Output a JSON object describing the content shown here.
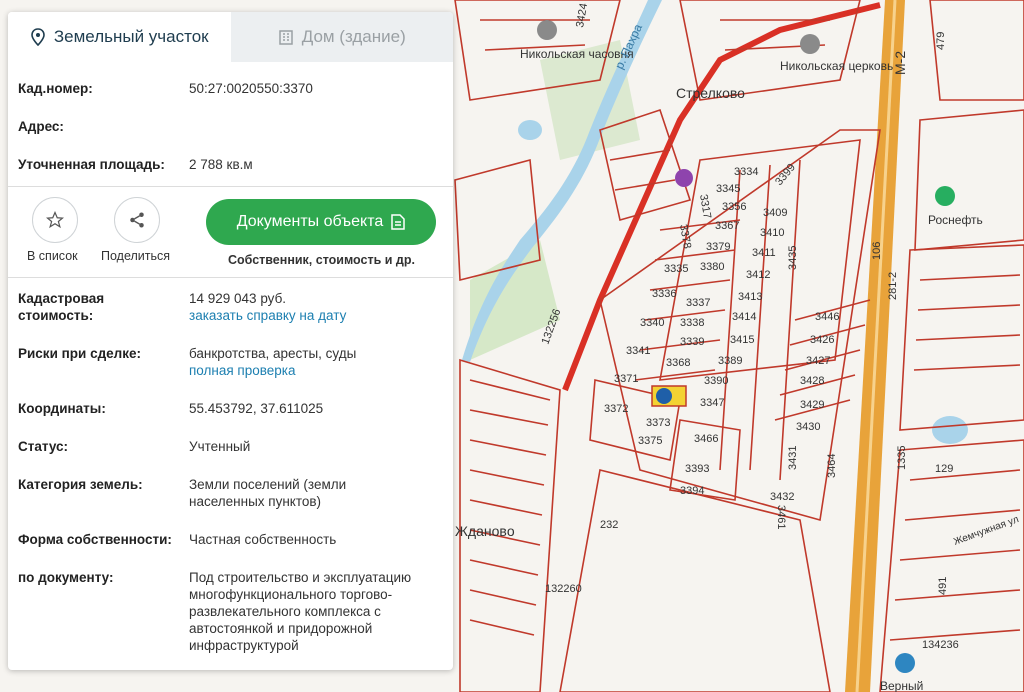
{
  "tabs": [
    {
      "label": "Земельный участок",
      "icon": "pin-icon"
    },
    {
      "label": "Дом (здание)",
      "icon": "building-icon"
    }
  ],
  "info": {
    "cadnum_label": "Кад.номер:",
    "cadnum_value": "50:27:0020550:3370",
    "address_label": "Адрес:",
    "area_label": "Уточненная площадь:",
    "area_value": "2 788 кв.м"
  },
  "actions": {
    "fav_label": "В список",
    "share_label": "Поделиться",
    "docs_button": "Документы объекта",
    "docs_sub": "Собственник, стоимость и др."
  },
  "details": {
    "cost_label_1": "Кадастровая",
    "cost_label_2": "стоимость:",
    "cost_value": "14 929 043 руб.",
    "cost_link": "заказать справку на дату",
    "risk_label": "Риски при сделке:",
    "risk_value": "банкротства, аресты, суды",
    "risk_link": "полная проверка",
    "coords_label": "Координаты:",
    "coords_value": "55.453792, 37.611025",
    "status_label": "Статус:",
    "status_value": "Учтенный",
    "category_label": "Категория земель:",
    "category_value_1": "Земли поселений (земли",
    "category_value_2": "населенных пунктов)",
    "ownership_label": "Форма собственности:",
    "ownership_value": "Частная собственность",
    "doc_label": "по документу:",
    "doc_value_1": "Под строительство и эксплуатацию",
    "doc_value_2": "многофункционального торгово-",
    "doc_value_3": "развлекательного комплекса с",
    "doc_value_4": "автостоянкой и придорожной",
    "doc_value_5": "инфраструктурой"
  },
  "map": {
    "places": [
      "Никольская часовня",
      "Никольская церковь",
      "Стрелково",
      "р. Пахра",
      "Ждановo",
      "Роснефть",
      "Верный",
      "Жемчужная ул"
    ],
    "parcels": [
      "3424",
      "479",
      "3334",
      "3399",
      "3345",
      "3356",
      "3409",
      "3367",
      "3410",
      "3317",
      "3378",
      "3379",
      "3380",
      "3411",
      "3412",
      "3335",
      "3336",
      "3413",
      "3337",
      "3338",
      "3414",
      "3340",
      "3339",
      "3415",
      "3341",
      "3368",
      "3389",
      "3390",
      "3446",
      "3426",
      "3427",
      "3428",
      "3429",
      "3430",
      "3371",
      "3372",
      "3373",
      "3375",
      "3347",
      "3466",
      "3435",
      "3393",
      "3394",
      "3431",
      "3464",
      "3461",
      "3432",
      "232",
      "132256",
      "132260",
      "1335",
      "129",
      "491",
      "134236",
      "106",
      "281-2",
      "М-2"
    ]
  },
  "colors": {
    "accent": "#2fa84f",
    "link": "#1c7fb0",
    "parcel_line": "#c0392b",
    "road": "#e8a33a",
    "river": "#a9d3ea",
    "marker": "#1f5fa8",
    "highlight": "#f3d233"
  }
}
